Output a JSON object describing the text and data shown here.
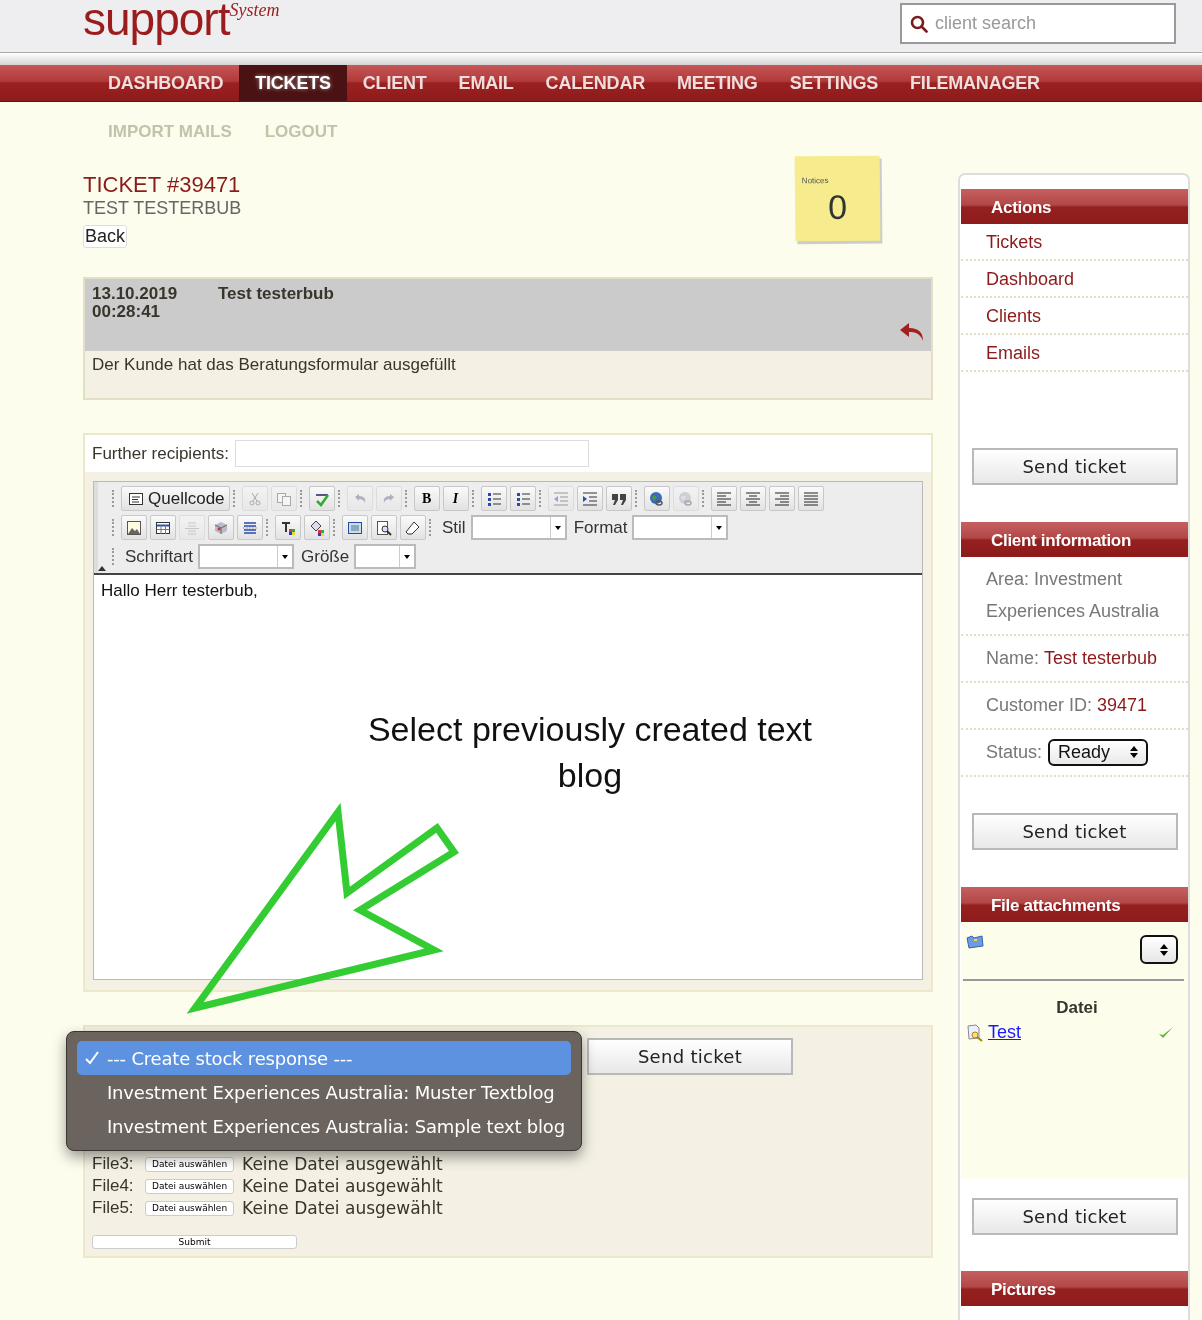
{
  "header": {
    "logo": "support",
    "logo_sup": "System",
    "search": {
      "placeholder": "client search"
    }
  },
  "nav": [
    {
      "label": "DASHBOARD",
      "selected": false
    },
    {
      "label": "TICKETS",
      "selected": true
    },
    {
      "label": "CLIENT",
      "selected": false
    },
    {
      "label": "EMAIL",
      "selected": false
    },
    {
      "label": "CALENDAR",
      "selected": false
    },
    {
      "label": "MEETING",
      "selected": false
    },
    {
      "label": "SETTINGS",
      "selected": false
    },
    {
      "label": "FILEMANAGER",
      "selected": false
    }
  ],
  "subnav": [
    "IMPORT MAILS",
    "LOGOUT"
  ],
  "ticket": {
    "title": "TICKET #39471",
    "client": "TEST TESTERBUB",
    "back": "Back"
  },
  "notices": {
    "label": "Notices",
    "count": "0"
  },
  "message": {
    "date": "13.10.2019 00:28:41",
    "author": "Test testerbub",
    "body": "Der Kunde hat das Beratungsformular ausgefüllt"
  },
  "compose": {
    "recipients_label": "Further recipients:",
    "toolbar": [
      [
        [
          {
            "kind": "source",
            "label": "Quellcode",
            "disabled": false
          }
        ],
        [
          {
            "kind": "cut",
            "disabled": true
          },
          {
            "kind": "copy",
            "disabled": true
          }
        ],
        [
          {
            "kind": "spell",
            "disabled": false
          }
        ],
        [
          {
            "kind": "undo",
            "disabled": true
          },
          {
            "kind": "redo",
            "disabled": true
          }
        ],
        [
          {
            "kind": "bold",
            "label": "B",
            "disabled": false
          },
          {
            "kind": "italic",
            "label": "I",
            "disabled": false
          }
        ],
        [
          {
            "kind": "ol",
            "disabled": false
          },
          {
            "kind": "ul",
            "disabled": false
          }
        ],
        [
          {
            "kind": "outdent",
            "disabled": true
          },
          {
            "kind": "indent",
            "disabled": false
          },
          {
            "kind": "quote",
            "disabled": false
          }
        ],
        [
          {
            "kind": "link",
            "disabled": false
          },
          {
            "kind": "unlink",
            "disabled": true
          }
        ],
        [
          {
            "kind": "left",
            "disabled": false
          },
          {
            "kind": "center",
            "disabled": false
          },
          {
            "kind": "right",
            "disabled": false
          },
          {
            "kind": "justify",
            "disabled": false
          }
        ]
      ],
      [
        [
          {
            "kind": "image",
            "disabled": false
          },
          {
            "kind": "table",
            "disabled": false
          },
          {
            "kind": "hr",
            "disabled": true
          },
          {
            "kind": "box",
            "disabled": false
          },
          {
            "kind": "pagebreak",
            "disabled": false
          }
        ],
        [
          {
            "kind": "textcolor",
            "disabled": false
          },
          {
            "kind": "bgcolor",
            "disabled": false
          }
        ],
        [
          {
            "kind": "blocks",
            "disabled": false
          },
          {
            "kind": "find",
            "disabled": false
          },
          {
            "kind": "eraser",
            "disabled": false
          }
        ],
        [
          {
            "kind": "select",
            "label": "Stil",
            "disabled": false
          },
          {
            "kind": "select",
            "label": "Format",
            "disabled": false
          }
        ]
      ],
      [
        [
          {
            "kind": "select",
            "label": "Schriftart",
            "disabled": false
          },
          {
            "kind": "select",
            "label": "Größe",
            "disabled": false
          }
        ]
      ]
    ],
    "body": "Hallo Herr testerbub,"
  },
  "annotation": {
    "text": "Select previously created text blog"
  },
  "reply": {
    "options": [
      {
        "label": "--- Create stock response ---",
        "selected": true
      },
      {
        "label": "Investment Experiences Australia: Muster Textblog",
        "selected": false
      },
      {
        "label": "Investment Experiences Australia: Sample text blog",
        "selected": false
      }
    ],
    "send": "Send ticket",
    "files": [
      {
        "label": "File3:",
        "button": "Datei auswählen",
        "status": "Keine Datei ausgewählt"
      },
      {
        "label": "File4:",
        "button": "Datei auswählen",
        "status": "Keine Datei ausgewählt"
      },
      {
        "label": "File5:",
        "button": "Datei auswählen",
        "status": "Keine Datei ausgewählt"
      }
    ],
    "submit": "Submit"
  },
  "sidebar": {
    "actions": {
      "title": "Actions",
      "links": [
        "Tickets",
        "Dashboard",
        "Clients",
        "Emails"
      ],
      "send": "Send ticket"
    },
    "client": {
      "title": "Client information",
      "area_label": "Area:",
      "area": "Investment Experiences Australia",
      "name_label": "Name:",
      "name": "Test testerbub",
      "id_label": "Customer ID:",
      "id": "39471",
      "status_label": "Status:",
      "status": "Ready",
      "send": "Send ticket"
    },
    "attachments": {
      "title": "File attachments",
      "column": "Datei",
      "files": [
        {
          "name": "Test",
          "checked": true
        }
      ],
      "send": "Send ticket"
    },
    "pictures": {
      "title": "Pictures"
    }
  }
}
